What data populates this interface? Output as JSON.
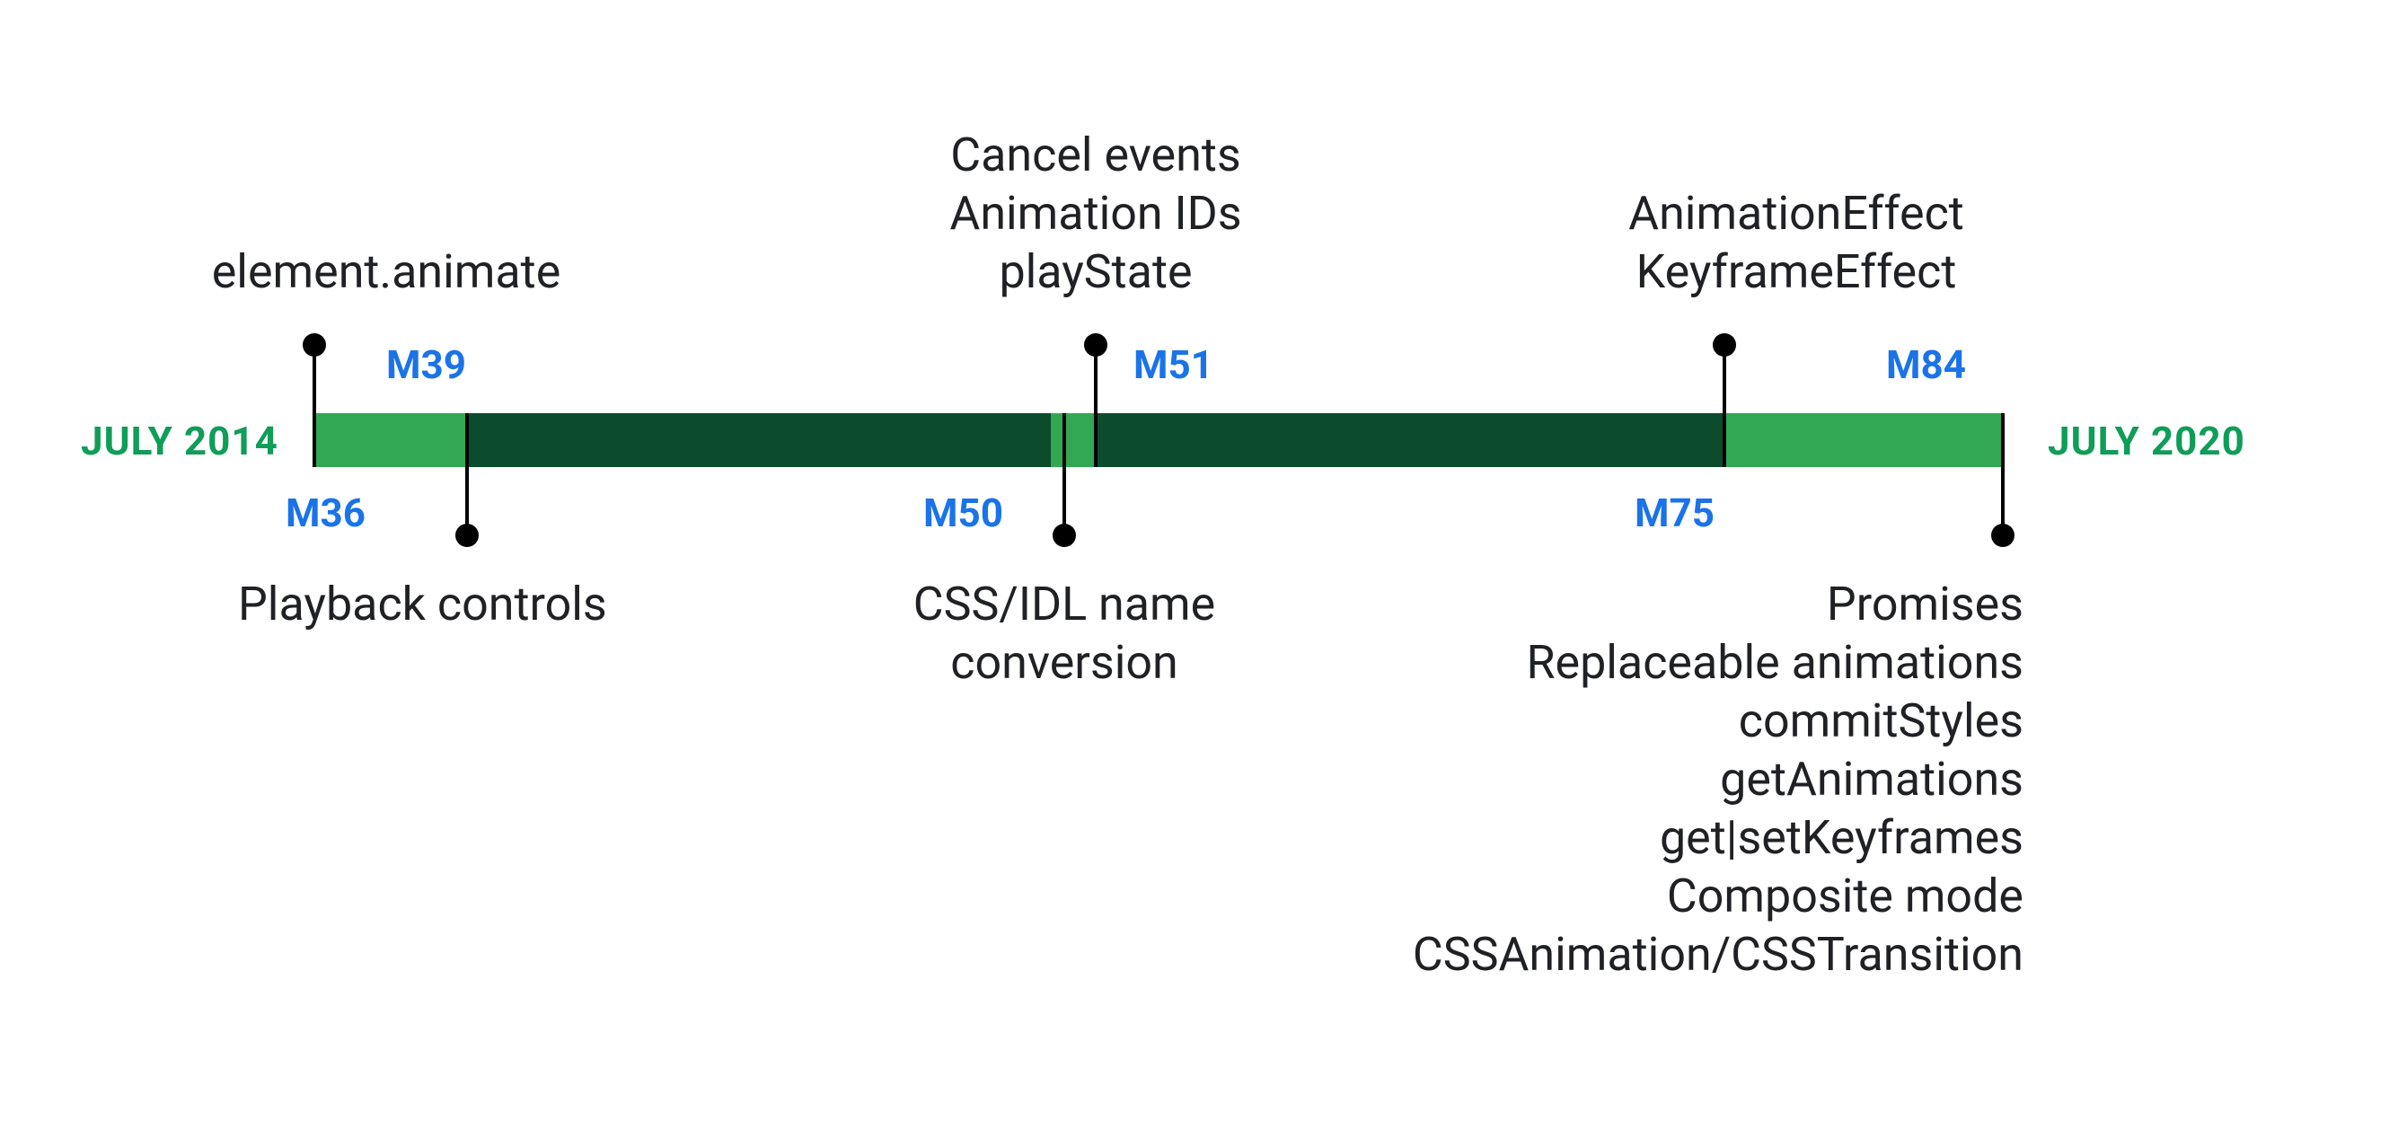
{
  "colors": {
    "bar_light": "#33a852",
    "bar_dark": "#0d4b2d",
    "accent_green": "#0f9d58",
    "accent_blue": "#1a73e8"
  },
  "timeline": {
    "start_label": "JULY 2014",
    "end_label": "JULY 2020"
  },
  "milestones": {
    "m36": "M36",
    "m39": "M39",
    "m50": "M50",
    "m51": "M51",
    "m75": "M75",
    "m84": "M84"
  },
  "events": {
    "m36": {
      "lines": [
        "element.animate"
      ]
    },
    "m39": {
      "lines": [
        "Playback controls"
      ]
    },
    "m50": {
      "lines": [
        "CSS/IDL name",
        "conversion"
      ]
    },
    "m51": {
      "lines": [
        "Cancel events",
        "Animation IDs",
        "playState"
      ]
    },
    "m75": {
      "lines": [
        "AnimationEffect",
        "KeyframeEffect"
      ]
    },
    "m84": {
      "lines": [
        "Promises",
        "Replaceable animations",
        "commitStyles",
        "getAnimations",
        "get|setKeyframes",
        "Composite mode",
        "CSSAnimation/CSSTransition"
      ]
    }
  },
  "chart_data": {
    "type": "timeline",
    "title": "",
    "range": {
      "start": "2014-07",
      "end": "2020-07"
    },
    "axis_labels": {
      "start": "JULY 2014",
      "end": "JULY 2020"
    },
    "segments": [
      {
        "name": "M36-M39",
        "style": "light",
        "from": "M36",
        "to": "M39"
      },
      {
        "name": "M39-M50",
        "style": "dark",
        "from": "M39",
        "to": "M50"
      },
      {
        "name": "M50-M51",
        "style": "light",
        "from": "M50",
        "to": "M51"
      },
      {
        "name": "M51-M75",
        "style": "dark",
        "from": "M51",
        "to": "M75"
      },
      {
        "name": "M75-M84",
        "style": "light",
        "from": "M75",
        "to": "M84"
      }
    ],
    "points": [
      {
        "id": "M36",
        "position": "above",
        "features": [
          "element.animate"
        ]
      },
      {
        "id": "M39",
        "position": "below",
        "features": [
          "Playback controls"
        ]
      },
      {
        "id": "M50",
        "position": "below",
        "features": [
          "CSS/IDL name conversion"
        ]
      },
      {
        "id": "M51",
        "position": "above",
        "features": [
          "Cancel events",
          "Animation IDs",
          "playState"
        ]
      },
      {
        "id": "M75",
        "position": "above",
        "features": [
          "AnimationEffect",
          "KeyframeEffect"
        ]
      },
      {
        "id": "M84",
        "position": "below",
        "features": [
          "Promises",
          "Replaceable animations",
          "commitStyles",
          "getAnimations",
          "get|setKeyframes",
          "Composite mode",
          "CSSAnimation/CSSTransition"
        ]
      }
    ]
  }
}
